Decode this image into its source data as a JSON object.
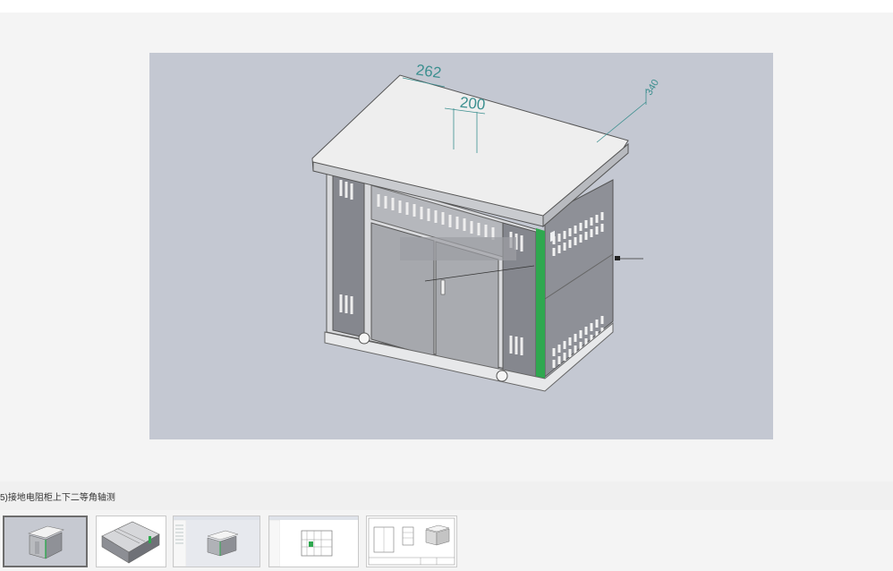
{
  "main_image": {
    "description_icon": "switchgear-cabinet-3d-model",
    "dimension_labels": [
      "262",
      "200",
      "340"
    ]
  },
  "caption": {
    "text": "5)接地电阻柜上下二等角轴测"
  },
  "thumbnails": [
    {
      "icon": "cabinet-isometric-thumbnail",
      "active": true
    },
    {
      "icon": "cabinet-underside-thumbnail",
      "active": false
    },
    {
      "icon": "cad-window-cabinet-thumbnail",
      "active": false
    },
    {
      "icon": "cad-window-interior-thumbnail",
      "active": false
    },
    {
      "icon": "drawing-sheet-thumbnail",
      "active": false
    }
  ],
  "colors": {
    "viewer_bg": "#f4f4f4",
    "image_bg": "#c4c8d2",
    "dimension_color": "#3b8f8f",
    "accent_green": "#2fa84f"
  }
}
